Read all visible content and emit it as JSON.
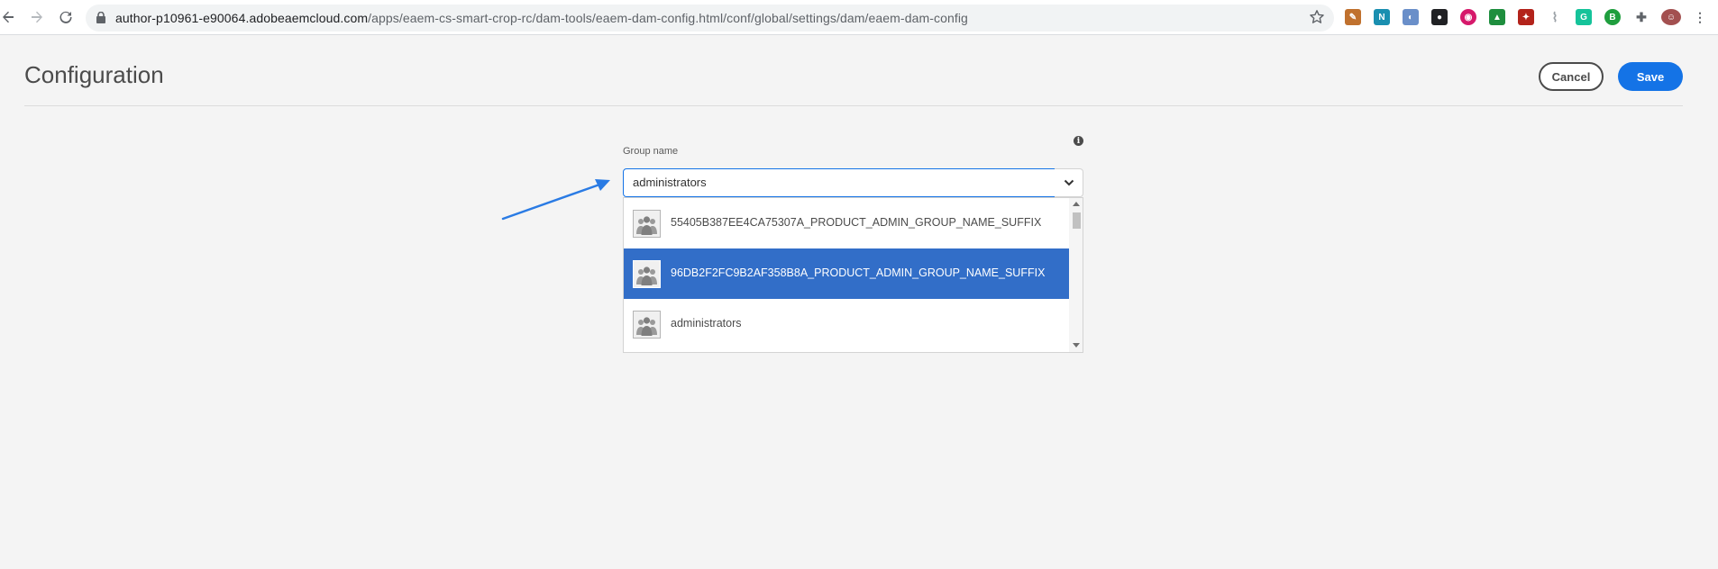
{
  "browser": {
    "url_host": "author-p10961-e90064.adobeaemcloud.com",
    "url_path": "/apps/eaem-cs-smart-crop-rc/dam-tools/eaem-dam-config.html/conf/global/settings/dam/eaem-dam-config",
    "back_icon": "arrow-left-icon",
    "forward_icon": "arrow-right-icon",
    "reload_icon": "reload-icon",
    "lock_icon": "lock-icon",
    "star_icon": "star-icon",
    "extensions": [
      {
        "name": "pen-extension",
        "color": "#c0712e",
        "glyph": "✎"
      },
      {
        "name": "n-extension",
        "color": "#1a8fb0",
        "glyph": "N"
      },
      {
        "name": "blue-round-extension",
        "color": "#6a8fc9",
        "glyph": "◐"
      },
      {
        "name": "spy-extension",
        "color": "#202124",
        "glyph": "●"
      },
      {
        "name": "eye-extension",
        "color": "#d6196b",
        "glyph": "◉"
      },
      {
        "name": "drive-extension",
        "color": "#1e8e3e",
        "glyph": "▲"
      },
      {
        "name": "red-square-extension",
        "color": "#b3231b",
        "glyph": "✦"
      },
      {
        "name": "leaf-extension",
        "color": "#9aa0a6",
        "glyph": "⌇"
      },
      {
        "name": "grammarly-extension",
        "color": "#15c39a",
        "glyph": "G"
      },
      {
        "name": "b-plus-extension",
        "color": "#1f9e3e",
        "glyph": "B"
      },
      {
        "name": "puzzle-extension",
        "color": "#5f6368",
        "glyph": "✚"
      },
      {
        "name": "profile-avatar",
        "color": "#a35050",
        "glyph": "☺"
      },
      {
        "name": "kebab-menu",
        "color": "#5f6368",
        "glyph": "⋮"
      }
    ]
  },
  "header": {
    "title": "Configuration",
    "cancel_label": "Cancel",
    "save_label": "Save"
  },
  "form": {
    "group_label": "Group name",
    "group_value": "administrators",
    "info_glyph": "i",
    "options": [
      {
        "label": "55405B387EE4CA75307A_PRODUCT_ADMIN_GROUP_NAME_SUFFIX",
        "selected": false
      },
      {
        "label": "96DB2F2FC9B2AF358B8A_PRODUCT_ADMIN_GROUP_NAME_SUFFIX",
        "selected": true
      },
      {
        "label": "administrators",
        "selected": false
      }
    ]
  },
  "colors": {
    "accent": "#1473e6",
    "selected_row": "#326ec8",
    "annotation_arrow": "#2a7be4"
  }
}
